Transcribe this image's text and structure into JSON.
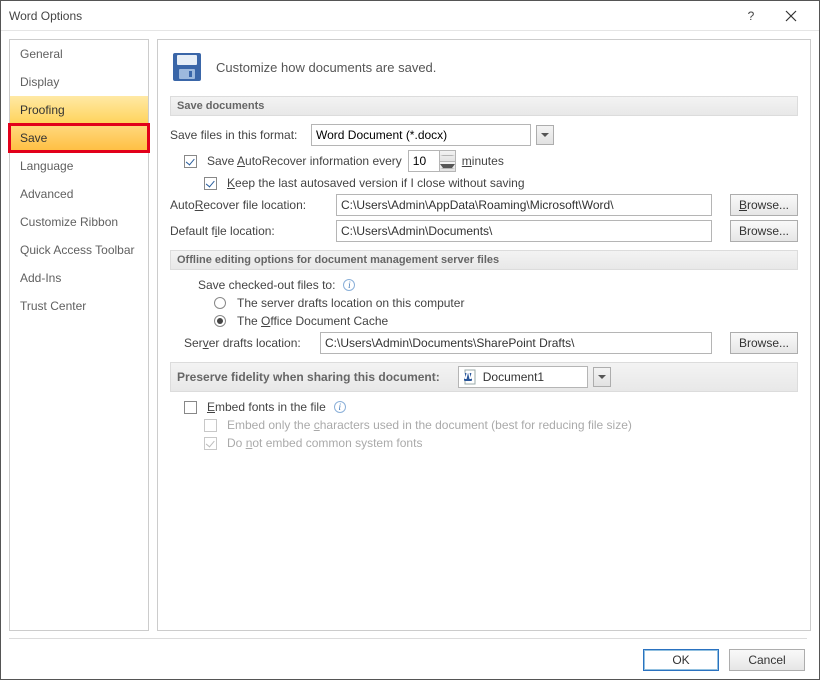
{
  "window": {
    "title": "Word Options"
  },
  "sidebar": {
    "items": [
      "General",
      "Display",
      "Proofing",
      "Save",
      "Language",
      "Advanced",
      "Customize Ribbon",
      "Quick Access Toolbar",
      "Add-Ins",
      "Trust Center"
    ]
  },
  "header": {
    "description": "Customize how documents are saved."
  },
  "sections": {
    "save_documents": "Save documents",
    "offline": "Offline editing options for document management server files",
    "preserve": "Preserve fidelity when sharing this document:"
  },
  "save": {
    "format_label": "Save files in this format:",
    "format_value": "Word Document (*.docx)",
    "autorecover_prefix": "Save ",
    "autorecover_mid": "utoRecover information every",
    "autorecover_u": "A",
    "autorecover_minutes": "10",
    "minutes_u": "m",
    "minutes_rest": "inutes",
    "keep_last_u": "K",
    "keep_last_rest": "eep the last autosaved version if I close without saving",
    "autorec_loc_label": "AutoRecover file location:",
    "autorec_loc_u": "R",
    "autorec_loc_value": "C:\\Users\\Admin\\AppData\\Roaming\\Microsoft\\Word\\",
    "default_loc_label_pre": "Default f",
    "default_loc_u": "i",
    "default_loc_label_post": "le location:",
    "default_loc_value": "C:\\Users\\Admin\\Documents\\",
    "browse": "Browse...",
    "browse_u": "B"
  },
  "offline": {
    "checked_out_label": "Save checked-out files to:",
    "opt1": "The server drafts location on this computer",
    "opt2_pre": "The ",
    "opt2_u": "O",
    "opt2_post": "ffice Document Cache",
    "drafts_label_pre": "Ser",
    "drafts_u": "v",
    "drafts_label_post": "er drafts location:",
    "drafts_value": "C:\\Users\\Admin\\Documents\\SharePoint Drafts\\"
  },
  "preserve": {
    "doc_name": "Document1",
    "embed_u": "E",
    "embed_rest": "mbed fonts in the file",
    "embed_only_pre": "Embed only the ",
    "embed_only_u": "c",
    "embed_only_post": "haracters used in the document (best for reducing file size)",
    "no_common_pre": "Do ",
    "no_common_u": "n",
    "no_common_post": "ot embed common system fonts"
  },
  "buttons": {
    "ok": "OK",
    "cancel": "Cancel"
  }
}
